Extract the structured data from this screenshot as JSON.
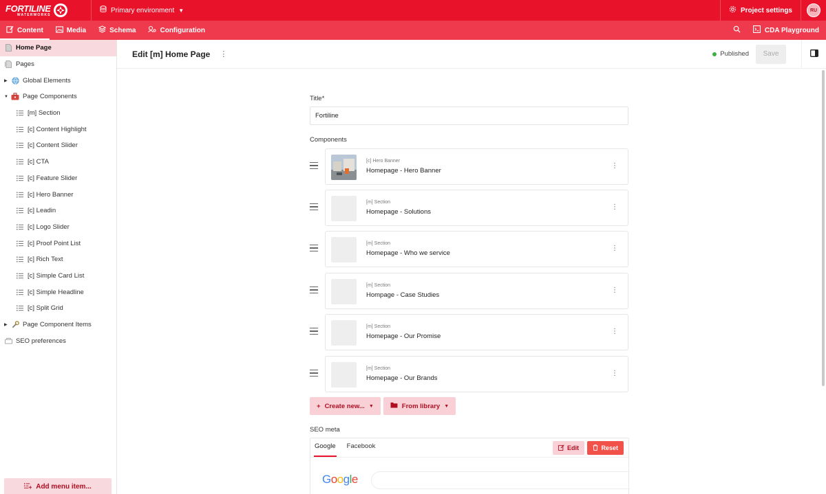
{
  "topbar": {
    "logo_main": "FORTILINE",
    "logo_sub": "WATERWORKS",
    "environment": "Primary environment",
    "project_settings": "Project settings",
    "avatar_initials": "RU"
  },
  "nav": {
    "tabs": [
      {
        "label": "Content",
        "icon": "edit-icon",
        "active": true
      },
      {
        "label": "Media",
        "icon": "image-icon",
        "active": false
      },
      {
        "label": "Schema",
        "icon": "layers-icon",
        "active": false
      },
      {
        "label": "Configuration",
        "icon": "config-icon",
        "active": false
      }
    ],
    "cda_playground": "CDA Playground"
  },
  "sidebar": {
    "items": [
      {
        "label": "Home Page",
        "icon": "page-icon",
        "active": true
      },
      {
        "label": "Pages",
        "icon": "pages-icon"
      },
      {
        "label": "Global Elements",
        "icon": "globe-icon",
        "arrow": "right"
      },
      {
        "label": "Page Components",
        "icon": "toolbox-icon",
        "arrow": "down"
      },
      {
        "label": "[m] Section",
        "icon": "list-icon"
      },
      {
        "label": "[c] Content Highlight",
        "icon": "list-icon"
      },
      {
        "label": "[c] Content Slider",
        "icon": "list-icon"
      },
      {
        "label": "[c] CTA",
        "icon": "list-icon"
      },
      {
        "label": "[c] Feature Slider",
        "icon": "list-icon"
      },
      {
        "label": "[c] Hero Banner",
        "icon": "list-icon"
      },
      {
        "label": "[c] Leadin",
        "icon": "list-icon"
      },
      {
        "label": "[c] Logo Slider",
        "icon": "list-icon"
      },
      {
        "label": "[c] Proof Point List",
        "icon": "list-icon"
      },
      {
        "label": "[c] Rich Text",
        "icon": "list-icon"
      },
      {
        "label": "[c] Simple Card List",
        "icon": "list-icon"
      },
      {
        "label": "[c] Simple Headline",
        "icon": "list-icon"
      },
      {
        "label": "[c] Split Grid",
        "icon": "list-icon"
      },
      {
        "label": "Page Component Items",
        "icon": "wrench-icon",
        "arrow": "right"
      },
      {
        "label": "SEO preferences",
        "icon": "seo-icon"
      }
    ],
    "add_menu_item": "Add menu item..."
  },
  "main": {
    "title": "Edit [m] Home Page",
    "status": "Published",
    "save_label": "Save",
    "status_color": "#3cb043"
  },
  "form": {
    "title_label": "Title*",
    "title_value": "Fortiline",
    "components_label": "Components",
    "components": [
      {
        "type": "[c] Hero Banner",
        "name": "Homepage - Hero Banner",
        "has_image": true
      },
      {
        "type": "[m] Section",
        "name": "Homepage - Solutions",
        "has_image": false
      },
      {
        "type": "[m] Section",
        "name": "Homepage - Who we service",
        "has_image": false
      },
      {
        "type": "[m] Section",
        "name": "Hompage - Case Studies",
        "has_image": false
      },
      {
        "type": "[m] Section",
        "name": "Homepage - Our Promise",
        "has_image": false
      },
      {
        "type": "[m] Section",
        "name": "Homepage - Our Brands",
        "has_image": false
      }
    ],
    "create_new": "Create new...",
    "from_library": "From library",
    "seo_label": "SEO meta",
    "seo_tabs": [
      "Google",
      "Facebook"
    ],
    "seo_edit": "Edit",
    "seo_reset": "Reset",
    "google_logo": "Google"
  },
  "colors": {
    "brand": "#e8122b",
    "nav": "#ee3a4c",
    "accent_light": "#f8d9dd"
  }
}
